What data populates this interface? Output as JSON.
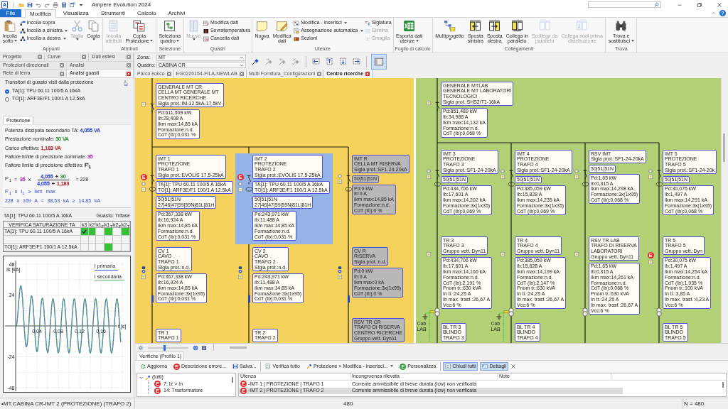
{
  "window": {
    "logo": "A",
    "title": "Ampère Evolution 2024",
    "help": "?"
  },
  "menu": [
    {
      "label": "File",
      "kind": "file",
      "selected": false
    },
    {
      "label": "Modifica",
      "kind": "tab",
      "selected": true
    },
    {
      "label": "Visualizza",
      "kind": "tab",
      "selected": false
    },
    {
      "label": "Strumenti",
      "kind": "tab",
      "selected": false
    },
    {
      "label": "Calcolo",
      "kind": "tab",
      "selected": false
    },
    {
      "label": "Archivi",
      "kind": "tab",
      "selected": false
    }
  ],
  "ribbon": [
    {
      "label": "Appunti",
      "buttons": [
        {
          "kind": "large",
          "lines": [
            "Incolla",
            "sotto"
          ],
          "dropdown": true,
          "disabled": false
        },
        {
          "kind": "stack",
          "items": [
            {
              "label": "Incolla sopra",
              "dropdown": false,
              "disabled": false
            },
            {
              "label": "Incolla a sinistra",
              "dropdown": true,
              "disabled": false
            },
            {
              "label": "Incolla a destra",
              "dropdown": true,
              "disabled": false
            }
          ]
        },
        {
          "kind": "large",
          "lines": [
            "Taglia"
          ],
          "dropdown": true,
          "disabled": true
        },
        {
          "kind": "large",
          "lines": [
            "Copia"
          ],
          "dropdown": true,
          "disabled": false
        }
      ]
    },
    {
      "label": "Attributi",
      "buttons": [
        {
          "kind": "large",
          "lines": [
            "Incolla",
            "attributi"
          ],
          "dropdown": false,
          "disabled": true
        },
        {
          "kind": "large",
          "lines": [
            "Copia",
            "Protezione"
          ],
          "dropdown": true,
          "disabled": false
        }
      ]
    },
    {
      "label": "Selezione",
      "buttons": [
        {
          "kind": "large",
          "lines": [
            "Seleziona",
            "quadro"
          ],
          "dropdown": true,
          "disabled": false
        }
      ]
    },
    {
      "label": "Quadri",
      "buttons": [
        {
          "kind": "large",
          "lines": [
            "Nuovo"
          ],
          "dropdown": true,
          "disabled": true
        },
        {
          "kind": "stack",
          "items": [
            {
              "label": "Modifica dati",
              "dropdown": false,
              "disabled": false
            },
            {
              "label": "Sovratemperatura",
              "dropdown": false,
              "disabled": false
            },
            {
              "label": "Cancella dati",
              "dropdown": false,
              "disabled": false
            }
          ]
        }
      ]
    },
    {
      "label": "Utenze",
      "buttons": [
        {
          "kind": "large",
          "lines": [
            "Nuova"
          ],
          "dropdown": true,
          "disabled": false
        },
        {
          "kind": "large",
          "lines": [
            "Modifica",
            "dati"
          ],
          "dropdown": false,
          "disabled": false
        },
        {
          "kind": "stack",
          "items": [
            {
              "label": "Modifica - inserisci",
              "dropdown": true,
              "disabled": false
            },
            {
              "label": "Assegnazione automatica",
              "dropdown": true,
              "disabled": false
            },
            {
              "label": "Sezioni",
              "dropdown": false,
              "disabled": false
            }
          ]
        },
        {
          "kind": "stack",
          "items": [
            {
              "label": "Siglatura",
              "dropdown": false,
              "disabled": false
            },
            {
              "label": "Elimina",
              "dropdown": false,
              "disabled": true
            },
            {
              "label": "Smaglia",
              "dropdown": false,
              "disabled": true
            }
          ]
        }
      ]
    },
    {
      "label": "Foglio di calcolo",
      "buttons": [
        {
          "kind": "large",
          "lines": [
            "Esporta dati",
            "utenze"
          ],
          "dropdown": true,
          "disabled": false
        }
      ]
    },
    {
      "label": "Collegamenti",
      "buttons": [
        {
          "kind": "large",
          "lines": [
            "Multiprogetto"
          ],
          "dropdown": true,
          "disabled": false
        },
        {
          "kind": "large",
          "lines": [
            "Sposta",
            "sinistra"
          ],
          "dropdown": false,
          "disabled": false
        },
        {
          "kind": "large",
          "lines": [
            "Sposta",
            "destra"
          ],
          "dropdown": false,
          "disabled": false
        },
        {
          "kind": "large",
          "lines": [
            "Collega in",
            "parallelo"
          ],
          "dropdown": false,
          "disabled": false
        },
        {
          "kind": "large",
          "lines": [
            "Scollega da",
            "parallelo"
          ],
          "dropdown": false,
          "disabled": true
        },
        {
          "kind": "large",
          "lines": [
            "Collega nodi prima",
            "distribuzione"
          ],
          "dropdown": false,
          "disabled": true
        }
      ]
    },
    {
      "label": "Trova",
      "buttons": [
        {
          "kind": "large",
          "lines": [
            "Trova e",
            "sostituisci"
          ],
          "dropdown": true,
          "disabled": false
        }
      ]
    }
  ],
  "side_tabs": [
    [
      {
        "label": "Progetto",
        "selected": false
      },
      {
        "label": "Curve",
        "selected": false
      },
      {
        "label": "Dati estesi",
        "selected": false
      }
    ],
    [
      {
        "label": "Protezioni direzionali",
        "selected": false
      },
      {
        "label": "Analisi",
        "selected": false
      }
    ],
    [
      {
        "label": "Rete di terra",
        "selected": false
      },
      {
        "label": "Analisi guasti",
        "selected": true
      }
    ]
  ],
  "fault_analysis": {
    "title": "Transitori di guasto visti dalla protezione",
    "transformers": [
      {
        "label": "TA[1]: TPU 60.11 100/5 A 16kA",
        "selected": true
      },
      {
        "label": "TO[1]: ARF3E/F1 100/1 A 12.5kA",
        "selected": false
      }
    ],
    "tabs": [
      {
        "label": "Protezione",
        "selected": true
      }
    ],
    "quantities": [
      {
        "label": "Potenza dissipata secondario TA:",
        "value": "4,055 VA",
        "color": "#3048d8"
      },
      {
        "label": "Prestazione nominale:",
        "value": "30 VA",
        "color": "#2e9a3a"
      },
      {
        "label": "Carico effettivo:",
        "value": "1,183 VA",
        "color": "#b0303a"
      },
      {
        "label": "Fattore limite di precisione nominale:",
        "value": "35",
        "color": "#b23ab2"
      },
      {
        "label": "Fattore limite di precisione effettivo:",
        "value": "F'$_{1}$",
        "color": "#222222"
      }
    ],
    "formula": {
      "lhs": "F'$_{1}$",
      "equals": "=",
      "factor": {
        "text": "35",
        "color": "#b23ab2"
      },
      "times": "x",
      "numerator": [
        {
          "text": "4,055",
          "color": "#3048d8"
        },
        {
          "text": "+",
          "color": "#222222"
        },
        {
          "text": "30",
          "color": "#2e9a3a"
        }
      ],
      "denominator": [
        {
          "text": "4,055",
          "color": "#3048d8"
        },
        {
          "text": "+",
          "color": "#222222"
        },
        {
          "text": "1,183",
          "color": "#b0303a"
        }
      ],
      "result": "= 228"
    },
    "conditions": [
      "F'$_{1}$ x I$_{1}$ ≥ Ikm max",
      "228 x 169 A = 38,53 kA ≥ 14,85 kA"
    ]
  },
  "saturation": {
    "device": "TA[1]: TPU 60.11 100/5 A 16kA",
    "fault": "Guasto: Trifase",
    "header": "VERIFICA SATURAZIONE TA",
    "columns": [
      "k3",
      "k2",
      "k1$_{F}$",
      "k1$_{T}$",
      "k2$_{F}$",
      "k2$_{T}$"
    ],
    "rows": [
      {
        "label": "TA[1]: TPU 60.11 100/5 A 16kA",
        "cells": [
          {
            "ok": true,
            "checked": true
          },
          {
            "ok": true,
            "checked": false
          },
          {
            "ok": false,
            "checked": false
          },
          {
            "ok": true,
            "checked": false
          },
          {
            "ok": false,
            "checked": false
          },
          {
            "ok": true,
            "checked": false
          }
        ]
      },
      {
        "cells": [
          {
            "ok": false,
            "checked": false
          },
          {
            "ok": false,
            "checked": false
          },
          {
            "ok": false,
            "checked": false
          },
          {
            "ok": false,
            "checked": false
          },
          {
            "ok": false,
            "checked": false
          },
          {
            "ok": false,
            "checked": false
          }
        ]
      },
      {
        "label": "TO[1]: ARF3E/F1 100/1 A 12.5kA",
        "cells": [
          {
            "ok": false,
            "checked": false
          },
          {
            "ok": false,
            "checked": false
          },
          {
            "ok": false,
            "checked": false
          },
          {
            "ok": true,
            "checked": false
          },
          {
            "ok": false,
            "checked": false
          },
          {
            "ok": false,
            "checked": false
          }
        ]
      }
    ]
  },
  "waveform": {
    "y_label": "Ik [kA]",
    "x_label": "t [s]",
    "y_ticks": [
      "48",
      "24",
      "-24",
      "-48"
    ],
    "x_ticks": [
      "0,04",
      "0,08",
      "0,12",
      "0,16"
    ],
    "legend": [
      {
        "label": "I primaria",
        "color": "#3a5fe0"
      },
      {
        "label": "I secondaria",
        "color": "#63b463"
      }
    ]
  },
  "selectors": [
    {
      "label": "Zona:",
      "value": "MT"
    },
    {
      "label": "Quadro:",
      "value": "CABINA CR"
    }
  ],
  "view_tools": [
    {
      "kind": "tool",
      "disabled": false,
      "selected": false
    },
    {
      "kind": "tool",
      "disabled": true,
      "selected": false
    },
    {
      "kind": "tool",
      "disabled": true,
      "selected": false
    },
    {
      "kind": "tool",
      "disabled": true,
      "selected": false
    },
    {
      "kind": "separator"
    },
    {
      "kind": "tool",
      "disabled": false,
      "selected": false
    },
    {
      "kind": "tool",
      "disabled": false,
      "selected": false
    },
    {
      "kind": "tool",
      "disabled": false,
      "selected": false
    },
    {
      "kind": "tool",
      "disabled": false,
      "selected": false
    },
    {
      "kind": "separator"
    },
    {
      "kind": "tool",
      "disabled": false,
      "selected": true
    }
  ],
  "documents": [
    {
      "label": "Parco eolico",
      "selected": false
    },
    {
      "label": "EG0220154-FILA-NEWLAB",
      "selected": false
    },
    {
      "label": "Multi Fornitura_Configurazioni",
      "selected": false
    },
    {
      "label": "Centro ricerche",
      "selected": true
    }
  ],
  "diagram": {
    "zones": [
      {
        "color": "#f5d25c",
        "units": [
          {
            "kind": "main",
            "selected": false,
            "inactive": false,
            "boxes": [
              [
                "GENERALE MT CR",
                "CELLA MT GENERALE MT",
                "CENTRO RICERCHE",
                "Sigla prot.:IM-12.5kA-17.5kV"
              ],
              [
                "Pd:611,309 kW",
                "Ib:28,408 A",
                "Ikm max:14,85 kA",
                "Formazione:n.d.",
                "CdT (Ib):0,031 %"
              ]
            ]
          },
          {
            "kind": "protection",
            "selected": false,
            "inactive": false,
            "badge": {
              "text": "E",
              "color": "#e52b2b"
            },
            "boxes": [
              [
                "IMT 1",
                "PROTEZIONE",
                "TRAFO 1",
                "Sigla prot.:EVOLIS 17.5-25kA"
              ],
              [
                "TA[1]: TPU 60.11 100/5 A 16kA",
                "TO[1]: ARF3E/F1 100/1 A 12.5kA"
              ],
              [
                "50|51|51N",
                "27|46|47|59|59N|81L|81H"
              ],
              [
                "Pd:367,338 kW",
                "Ib:16,924 A",
                "Ikm max:14,85 kA",
                "Formazione:n.d.",
                "CdT (Ib):0,031 %"
              ]
            ]
          },
          {
            "kind": "protection",
            "selected": true,
            "inactive": false,
            "badge": {
              "text": "E",
              "color": "#e52b2b"
            },
            "boxes": [
              [
                "IMT 2",
                "PROTEZIONE",
                "TRAFO 2",
                "Sigla prot.:EVOLIS 17.5-25kA"
              ],
              [
                "TA[1]: TPU 60.11 100/5 A 16kA",
                "TO[1]: ARF3E/F1 100/1 A 12.5kA"
              ],
              [
                "50|51|51N",
                "27|46|47|59|59N|81L|81H"
              ],
              [
                "Pd:243,971 kW",
                "Ib:11,488 A",
                "Ikm max:14,85 kA",
                "Formazione:n.d.",
                "CdT (Ib):0,031 %"
              ]
            ]
          },
          {
            "kind": "protection",
            "selected": false,
            "inactive": true,
            "boxes": [
              [
                "IMT R",
                "CELLA MT RISERVA",
                "Sigla prot.:SF1-24-20kA"
              ],
              [
                "50|51|51N"
              ],
              [
                "Pd:0 kW",
                "Ib:0 A",
                "Ikm max:14,85 kA",
                "Formazione:n.d.",
                "CdT (Ib):0 %"
              ]
            ]
          },
          {
            "kind": "cable",
            "selected": false,
            "inactive": false,
            "boxes": [
              [
                "CV 1",
                "CAVO",
                "TRAFO 1",
                "Sigla prot.:n.d."
              ],
              [
                "Pd:367,338 kW",
                "Ib:16,924 A",
                "Ikm max:14,85 kA",
                "Formazione:3x(1x95)",
                "CdT (Ib):0,031 %"
              ]
            ]
          },
          {
            "kind": "cable",
            "selected": false,
            "inactive": false,
            "boxes": [
              [
                "CV 2",
                "CAVO",
                "TRAFO 2",
                "Sigla prot.:n.d."
              ],
              [
                "Pd:243,971 kW",
                "Ib:11,488 A",
                "Ikm max:14,85 kA",
                "Formazione:3x(1x95)",
                "CdT (Ib):0,031 %"
              ]
            ]
          },
          {
            "kind": "cable",
            "selected": false,
            "inactive": true,
            "boxes": [
              [
                "CV R",
                "RISERVA",
                "Sigla prot.:n.d."
              ],
              [
                "Pd:0 kW",
                "Ib:0 A",
                "Ikm max:0 kA",
                "Formazione:3x(1x95)",
                "CdT (Ib):0 %"
              ]
            ]
          },
          {
            "kind": "transformer",
            "selected": false,
            "inactive": false,
            "boxes": [
              [
                "TR 1",
                "TRAFO 1"
              ]
            ]
          },
          {
            "kind": "transformer",
            "selected": false,
            "inactive": false,
            "boxes": [
              [
                "TR 2",
                "TRAFO 2"
              ]
            ]
          },
          {
            "kind": "transformer",
            "selected": false,
            "inactive": true,
            "boxes": [
              [
                "RSV TR CR",
                "TRAFO DI RISERVA",
                "CENTRO RICERCHE",
                "Gruppo vett.:Dyn11"
              ]
            ]
          }
        ]
      },
      {
        "color": "#b4d077",
        "units": [
          {
            "kind": "main",
            "selected": false,
            "inactive": false,
            "boxes": [
              [
                "GENERALE MTLAB",
                "GENERALE MT LABORATORI",
                "TECNOLOGICI",
                "Sigla prot.:SHS2/T1-16kA"
              ],
              [
                "Pd:851,489 kW",
                "Ib:34,986 A",
                "Ikm max:14,132 kA",
                "Formazione:n.d.",
                "CdT (Ib):0,068 %"
              ]
            ]
          },
          {
            "kind": "protection",
            "selected": false,
            "inactive": false,
            "boxes": [
              [
                "IMT 3",
                "PROTEZIONE",
                "TRAFO 3",
                "Sigla prot.:SF1-24-20kA"
              ],
              [
                "50|51|51N"
              ],
              [
                "Pd:434,706 kW",
                "Ib:17,601 A",
                "Ikm max:14,202 kA",
                "Formazione:3x(1x35)",
                "CdT (Ib):0,069 %"
              ]
            ]
          },
          {
            "kind": "protection",
            "selected": false,
            "inactive": false,
            "boxes": [
              [
                "IMT 4",
                "PROTEZIONE",
                "TRAFO 4",
                "Sigla prot.:SF1-24-20kA"
              ],
              [
                "50|51|51N"
              ],
              [
                "Pd:385,059 kW",
                "Ib:15,828 A",
                "Ikm max:14,235 kA",
                "Formazione:3x(1x35)",
                "CdT (Ib):0,069 %"
              ]
            ]
          },
          {
            "kind": "protection",
            "selected": false,
            "inactive": false,
            "boxes": [
              [
                "RSV IMT",
                "Sigla prot.:SF1-24-20kA"
              ],
              [
                "50|51|51N"
              ],
              [
                "Pd:1,65 kW",
                "Ib:0,315 A",
                "Ikm max:14,298 kA",
                "Formazione:3x(1x95)",
                "CdT (Ib):0,068 %"
              ]
            ]
          },
          {
            "kind": "protection",
            "selected": false,
            "inactive": false,
            "boxes": [
              [
                "IMT 5",
                "PROTEZIONE",
                "TRAFO 5",
                "Sigla prot.:SF1-24-20k"
              ],
              [
                "50|51|51N"
              ],
              [
                "Pd:30,075 kW",
                "Ib:1,497 A",
                "Ikm max:14,291 kA",
                "Formazione:3x(1x95)",
                "CdT (Ib):0,068 %"
              ]
            ]
          },
          {
            "kind": "transformer",
            "selected": false,
            "inactive": false,
            "ground": {
              "label": "Cab LAB"
            },
            "boxes": [
              [
                "TR 3",
                "TRAFO 3",
                "Gruppo vett.:Dyn11"
              ],
              [
                "Pd:434,706 kW",
                "Ib:17,601 A",
                "Ikm max:14,166 kA",
                "Formazione:n.d.",
                "CdT (Ib):2,191 %",
                "Pnom tr.:630 kVA",
                "In tr.:24,25 A",
                "Ib max. trasf.:26,67 A",
                "Vcc:6 %"
              ]
            ]
          },
          {
            "kind": "transformer",
            "selected": false,
            "inactive": false,
            "ground": {
              "label": "Cab LAB"
            },
            "boxes": [
              [
                "TR 4",
                "TRAFO 4",
                "Gruppo vett.:Dyn11"
              ],
              [
                "Pd:385,059 kW",
                "Ib:15,828 A",
                "Ikm max:14,199 kA",
                "Formazione:n.d.",
                "CdT (Ib):2,147 %",
                "Pnom tr.:630 kVA",
                "In tr.:24,25 A",
                "Ib max. trasf.:26,67 A",
                "Vcc:6 %"
              ]
            ]
          },
          {
            "kind": "transformer",
            "selected": false,
            "inactive": false,
            "boxes": [
              [
                "RSV TR LAB",
                "TRAFO DI RISERVA",
                "LABORATORI",
                "Gruppo vett.:Dyn11"
              ],
              [
                "Pd:1,65 kW",
                "Ib:0,315 A",
                "Ikm max:14,261 kA",
                "Formazione:n.d.",
                "CdT (Ib):0,068 %",
                "Pnom tr.:630 kVA",
                "In tr.:24,25 A",
                "Ib max. trasf.:26,67 A",
                "Vcc:6 %"
              ]
            ]
          },
          {
            "kind": "transformer",
            "selected": false,
            "inactive": false,
            "badge": {
              "text": "E",
              "color": "#e52b2b"
            },
            "boxes": [
              [
                "TR 5",
                "TRAFO 5",
                "Gruppo vett.:Dyn"
              ],
              [
                "Pd:30,075 kW",
                "Ib:1,497 A",
                "Ikm max:14,254 kA",
                "Formazione:n.d.",
                "CdT (Ib):1,935 %",
                "Pnom tr.:100 kVA",
                "In tr.:3,85 A",
                "Ib max. trasf.:4,23 A",
                "Vcc:6 %"
              ]
            ]
          },
          {
            "kind": "busway",
            "selected": false,
            "inactive": false,
            "boxes": [
              [
                "BL TR 3",
                "BLINDO",
                "TRAFO 3"
              ]
            ]
          },
          {
            "kind": "busway",
            "selected": false,
            "inactive": false,
            "boxes": [
              [
                "BL TR 4",
                "BLINDO",
                "TRAFO 4"
              ]
            ]
          },
          {
            "kind": "busway",
            "selected": false,
            "inactive": false,
            "boxes": [
              [
                "BL TR 5",
                "BLINDO",
                "TRAFO 5"
              ]
            ]
          }
        ]
      }
    ],
    "zoom": {
      "level": 0.42
    }
  },
  "checks": {
    "title": "Verifiche (Profilo 1)",
    "toolbar": [
      {
        "kind": "button",
        "label": "Aggiorna",
        "pressed": false
      },
      {
        "kind": "button",
        "label": "Descrizione errore...",
        "badge": {
          "text": "E",
          "color": "#e02b2b"
        },
        "pressed": false
      },
      {
        "kind": "button",
        "label": "Salva...",
        "pressed": false
      },
      {
        "kind": "separator"
      },
      {
        "kind": "button",
        "label": "Verifica tutto",
        "pressed": false
      },
      {
        "kind": "button",
        "label": "Protezione > Modifica - inserisci...",
        "dropdown": true,
        "pressed": false
      },
      {
        "kind": "button",
        "label": "Personalizza",
        "badge": {
          "text": "E",
          "color": "#2f9e3a"
        },
        "pressed": false
      },
      {
        "kind": "separator"
      },
      {
        "kind": "button",
        "label": "Chiudi tutti",
        "pressed": true
      },
      {
        "kind": "button",
        "label": "Dettagli",
        "pressed": true
      }
    ],
    "tree": {
      "label": "(tutti)",
      "expanded": true,
      "children": [
        {
          "label": "7: Iz > In",
          "badge": {
            "text": "E",
            "color": "#e02b2b"
          }
        },
        {
          "label": "14: Trasformatore",
          "badge": {
            "text": "E",
            "color": "#e02b2b"
          }
        }
      ]
    },
    "table": {
      "columns": [
        "Utenza",
        "Incongruenza rilevata",
        "Note"
      ],
      "rows": [
        {
          "selected": false,
          "badge": {
            "text": "E",
            "color": "#e02b2b"
          },
          "cells": [
            "-IMT 1 | PROTEZIONE | TRAFO 1",
            "Corrente ammissibile di breve durata (Icw) non verificata"
          ]
        },
        {
          "selected": true,
          "badge": {
            "text": "E",
            "color": "#e02b2b"
          },
          "cells": [
            "-IMT 2 | PROTEZIONE | TRAFO 2",
            "Corrente ammissibile di breve durata (Icw) non verificata"
          ]
        }
      ]
    }
  },
  "status_bar": [
    "•MT.CABINA CR-IMT 2 (PROTEZIONE) (TRAFO 2)",
    "480",
    "N = 480"
  ]
}
